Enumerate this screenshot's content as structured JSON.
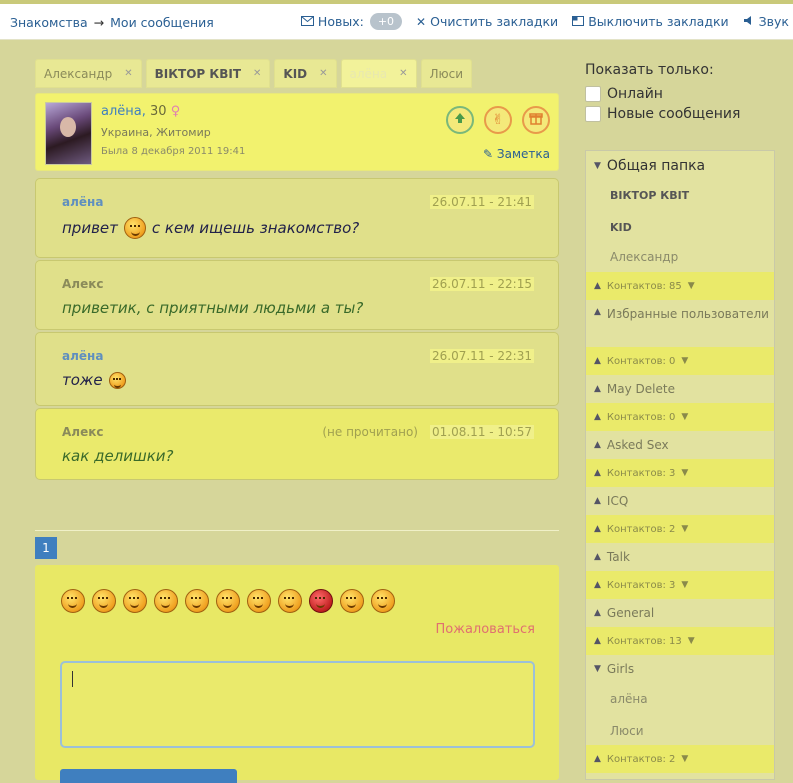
{
  "breadcrumb": {
    "home": "Знакомства",
    "arrow": "→",
    "current": "Мои сообщения"
  },
  "topnav": {
    "new_label": "Новых:",
    "new_count": "+0",
    "clear_label": "Очистить закладки",
    "disable_label": "Выключить закладки",
    "sound_label": "Звук"
  },
  "tabs": [
    {
      "label": "Александр"
    },
    {
      "label": "ВІКТОР КВІТ"
    },
    {
      "label": "KID"
    },
    {
      "label": "алёна"
    },
    {
      "label": "Люси"
    }
  ],
  "profile": {
    "name": "алёна,",
    "age": "30",
    "location": "Украина, Житомир",
    "last_seen": "Была 8 декабря 2011 19:41",
    "note_label": "Заметка"
  },
  "messages": [
    {
      "author": "алёна",
      "date": "26.07.11 - 21:41",
      "text_a": "привет",
      "text_b": "с кем ищешь знакомство?"
    },
    {
      "author": "Алекс",
      "date": "26.07.11 - 22:15",
      "text_a": "приветик, с приятными людьми а ты?"
    },
    {
      "author": "алёна",
      "date": "26.07.11 - 22:31",
      "text_a": "тоже"
    },
    {
      "author": "Алекс",
      "status": "(не прочитано)",
      "date": "01.08.11 - 10:57",
      "text_a": "как делишки?"
    }
  ],
  "pagination": {
    "current": "1"
  },
  "compose": {
    "report_label": "Пожаловаться"
  },
  "filter": {
    "title": "Показать только:",
    "online_label": "Онлайн",
    "new_messages_label": "Новые сообщения"
  },
  "folders": {
    "general_folder": "Общая папка",
    "items": [
      "ВІКТОР КВІТ",
      "KID",
      "Александр",
      "Контактов: 85",
      "Избранные пользователи",
      "Контактов: 0",
      "May Delete",
      "Контактов: 0",
      "Asked Sex",
      "Контактов: 3",
      "ICQ",
      "Контактов: 2",
      "Talk",
      "Контактов: 3",
      "General",
      "Контактов: 13",
      "Girls",
      "алёна",
      "Люси",
      "Контактов: 2"
    ]
  },
  "colors": {
    "accent": "#3f7fbf",
    "highlight": "#eaea6a",
    "report": "#e07070"
  }
}
